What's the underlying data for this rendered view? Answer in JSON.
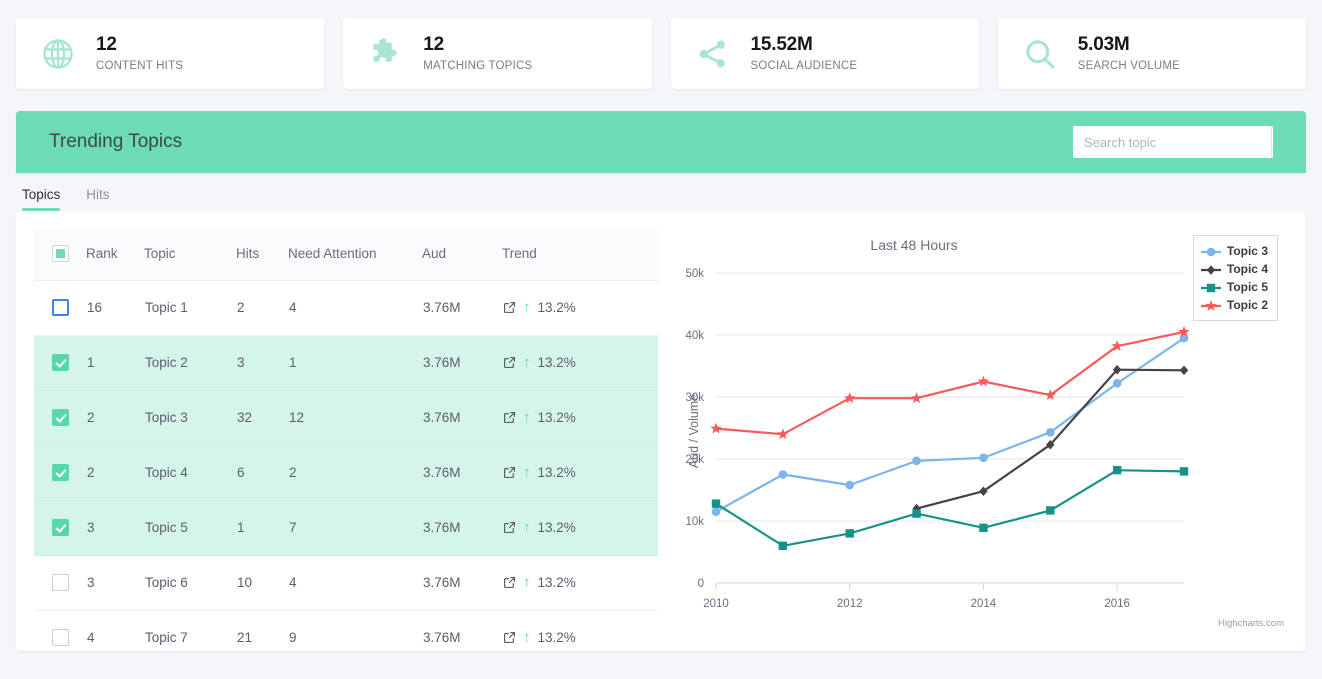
{
  "stats": [
    {
      "icon": "globe-icon",
      "value": "12",
      "label": "CONTENT HITS"
    },
    {
      "icon": "puzzle-icon",
      "value": "12",
      "label": "MATCHING TOPICS"
    },
    {
      "icon": "share-icon",
      "value": "15.52M",
      "label": "SOCIAL AUDIENCE"
    },
    {
      "icon": "search-icon",
      "value": "5.03M",
      "label": "SEARCH VOLUME"
    }
  ],
  "panel": {
    "title": "Trending Topics",
    "search": {
      "placeholder": "Search topic",
      "value": "",
      "icon": "search-icon"
    },
    "header_bg": "#6ddcb4"
  },
  "tabs": [
    {
      "label": "Topics",
      "active": true
    },
    {
      "label": "Hits",
      "active": false
    }
  ],
  "table": {
    "columns": [
      "",
      "Rank",
      "Topic",
      "Hits",
      "Need Attention",
      "Aud",
      "Trend"
    ],
    "header_checkbox_state": "indeterminate",
    "rows": [
      {
        "checked": false,
        "focused": true,
        "rank": "16",
        "topic": "Topic 1",
        "hits": "2",
        "need_attention": "4",
        "aud": "3.76M",
        "trend": "13.2%",
        "trend_dir": "up"
      },
      {
        "checked": true,
        "focused": false,
        "rank": "1",
        "topic": "Topic 2",
        "hits": "3",
        "need_attention": "1",
        "aud": "3.76M",
        "trend": "13.2%",
        "trend_dir": "up"
      },
      {
        "checked": true,
        "focused": false,
        "rank": "2",
        "topic": "Topic 3",
        "hits": "32",
        "need_attention": "12",
        "aud": "3.76M",
        "trend": "13.2%",
        "trend_dir": "up"
      },
      {
        "checked": true,
        "focused": false,
        "rank": "2",
        "topic": "Topic 4",
        "hits": "6",
        "need_attention": "2",
        "aud": "3.76M",
        "trend": "13.2%",
        "trend_dir": "up"
      },
      {
        "checked": true,
        "focused": false,
        "rank": "3",
        "topic": "Topic 5",
        "hits": "1",
        "need_attention": "7",
        "aud": "3.76M",
        "trend": "13.2%",
        "trend_dir": "up"
      },
      {
        "checked": false,
        "focused": false,
        "rank": "3",
        "topic": "Topic 6",
        "hits": "10",
        "need_attention": "4",
        "aud": "3.76M",
        "trend": "13.2%",
        "trend_dir": "up"
      },
      {
        "checked": false,
        "focused": false,
        "rank": "4",
        "topic": "Topic 7",
        "hits": "21",
        "need_attention": "9",
        "aud": "3.76M",
        "trend": "13.2%",
        "trend_dir": "up"
      }
    ]
  },
  "chart_data": {
    "type": "line",
    "title": "Last 48 Hours",
    "xlabel": "",
    "ylabel": "Aud / Volume",
    "x": [
      2010,
      2011,
      2012,
      2013,
      2014,
      2015,
      2016,
      2017
    ],
    "xtick_labels": [
      "2010",
      "2012",
      "2014",
      "2016"
    ],
    "xticks": [
      2010,
      2012,
      2014,
      2016
    ],
    "xlim": [
      2010,
      2017
    ],
    "ytick_labels": [
      "0",
      "10k",
      "20k",
      "30k",
      "40k",
      "50k"
    ],
    "yticks": [
      0,
      10000,
      20000,
      30000,
      40000,
      50000
    ],
    "ylim": [
      0,
      50000
    ],
    "grid": true,
    "legend_position": "top-right",
    "credit": "Highcharts.com",
    "series": [
      {
        "name": "Topic 3",
        "color": "#7cb5ec",
        "marker": "circle",
        "values": [
          11500,
          17500,
          15800,
          19700,
          20200,
          24300,
          32200,
          39500
        ]
      },
      {
        "name": "Topic 4",
        "color": "#434348",
        "marker": "diamond",
        "values": [
          null,
          null,
          null,
          12000,
          14800,
          22300,
          34400,
          34300
        ]
      },
      {
        "name": "Topic 5",
        "color": "#179287",
        "marker": "square",
        "values": [
          12800,
          6000,
          8000,
          11200,
          8900,
          11700,
          18200,
          18000
        ]
      },
      {
        "name": "Topic 2",
        "color": "#f45b5b",
        "marker": "star",
        "values": [
          24900,
          24000,
          29800,
          29800,
          32500,
          30300,
          38200,
          40500
        ]
      }
    ]
  }
}
